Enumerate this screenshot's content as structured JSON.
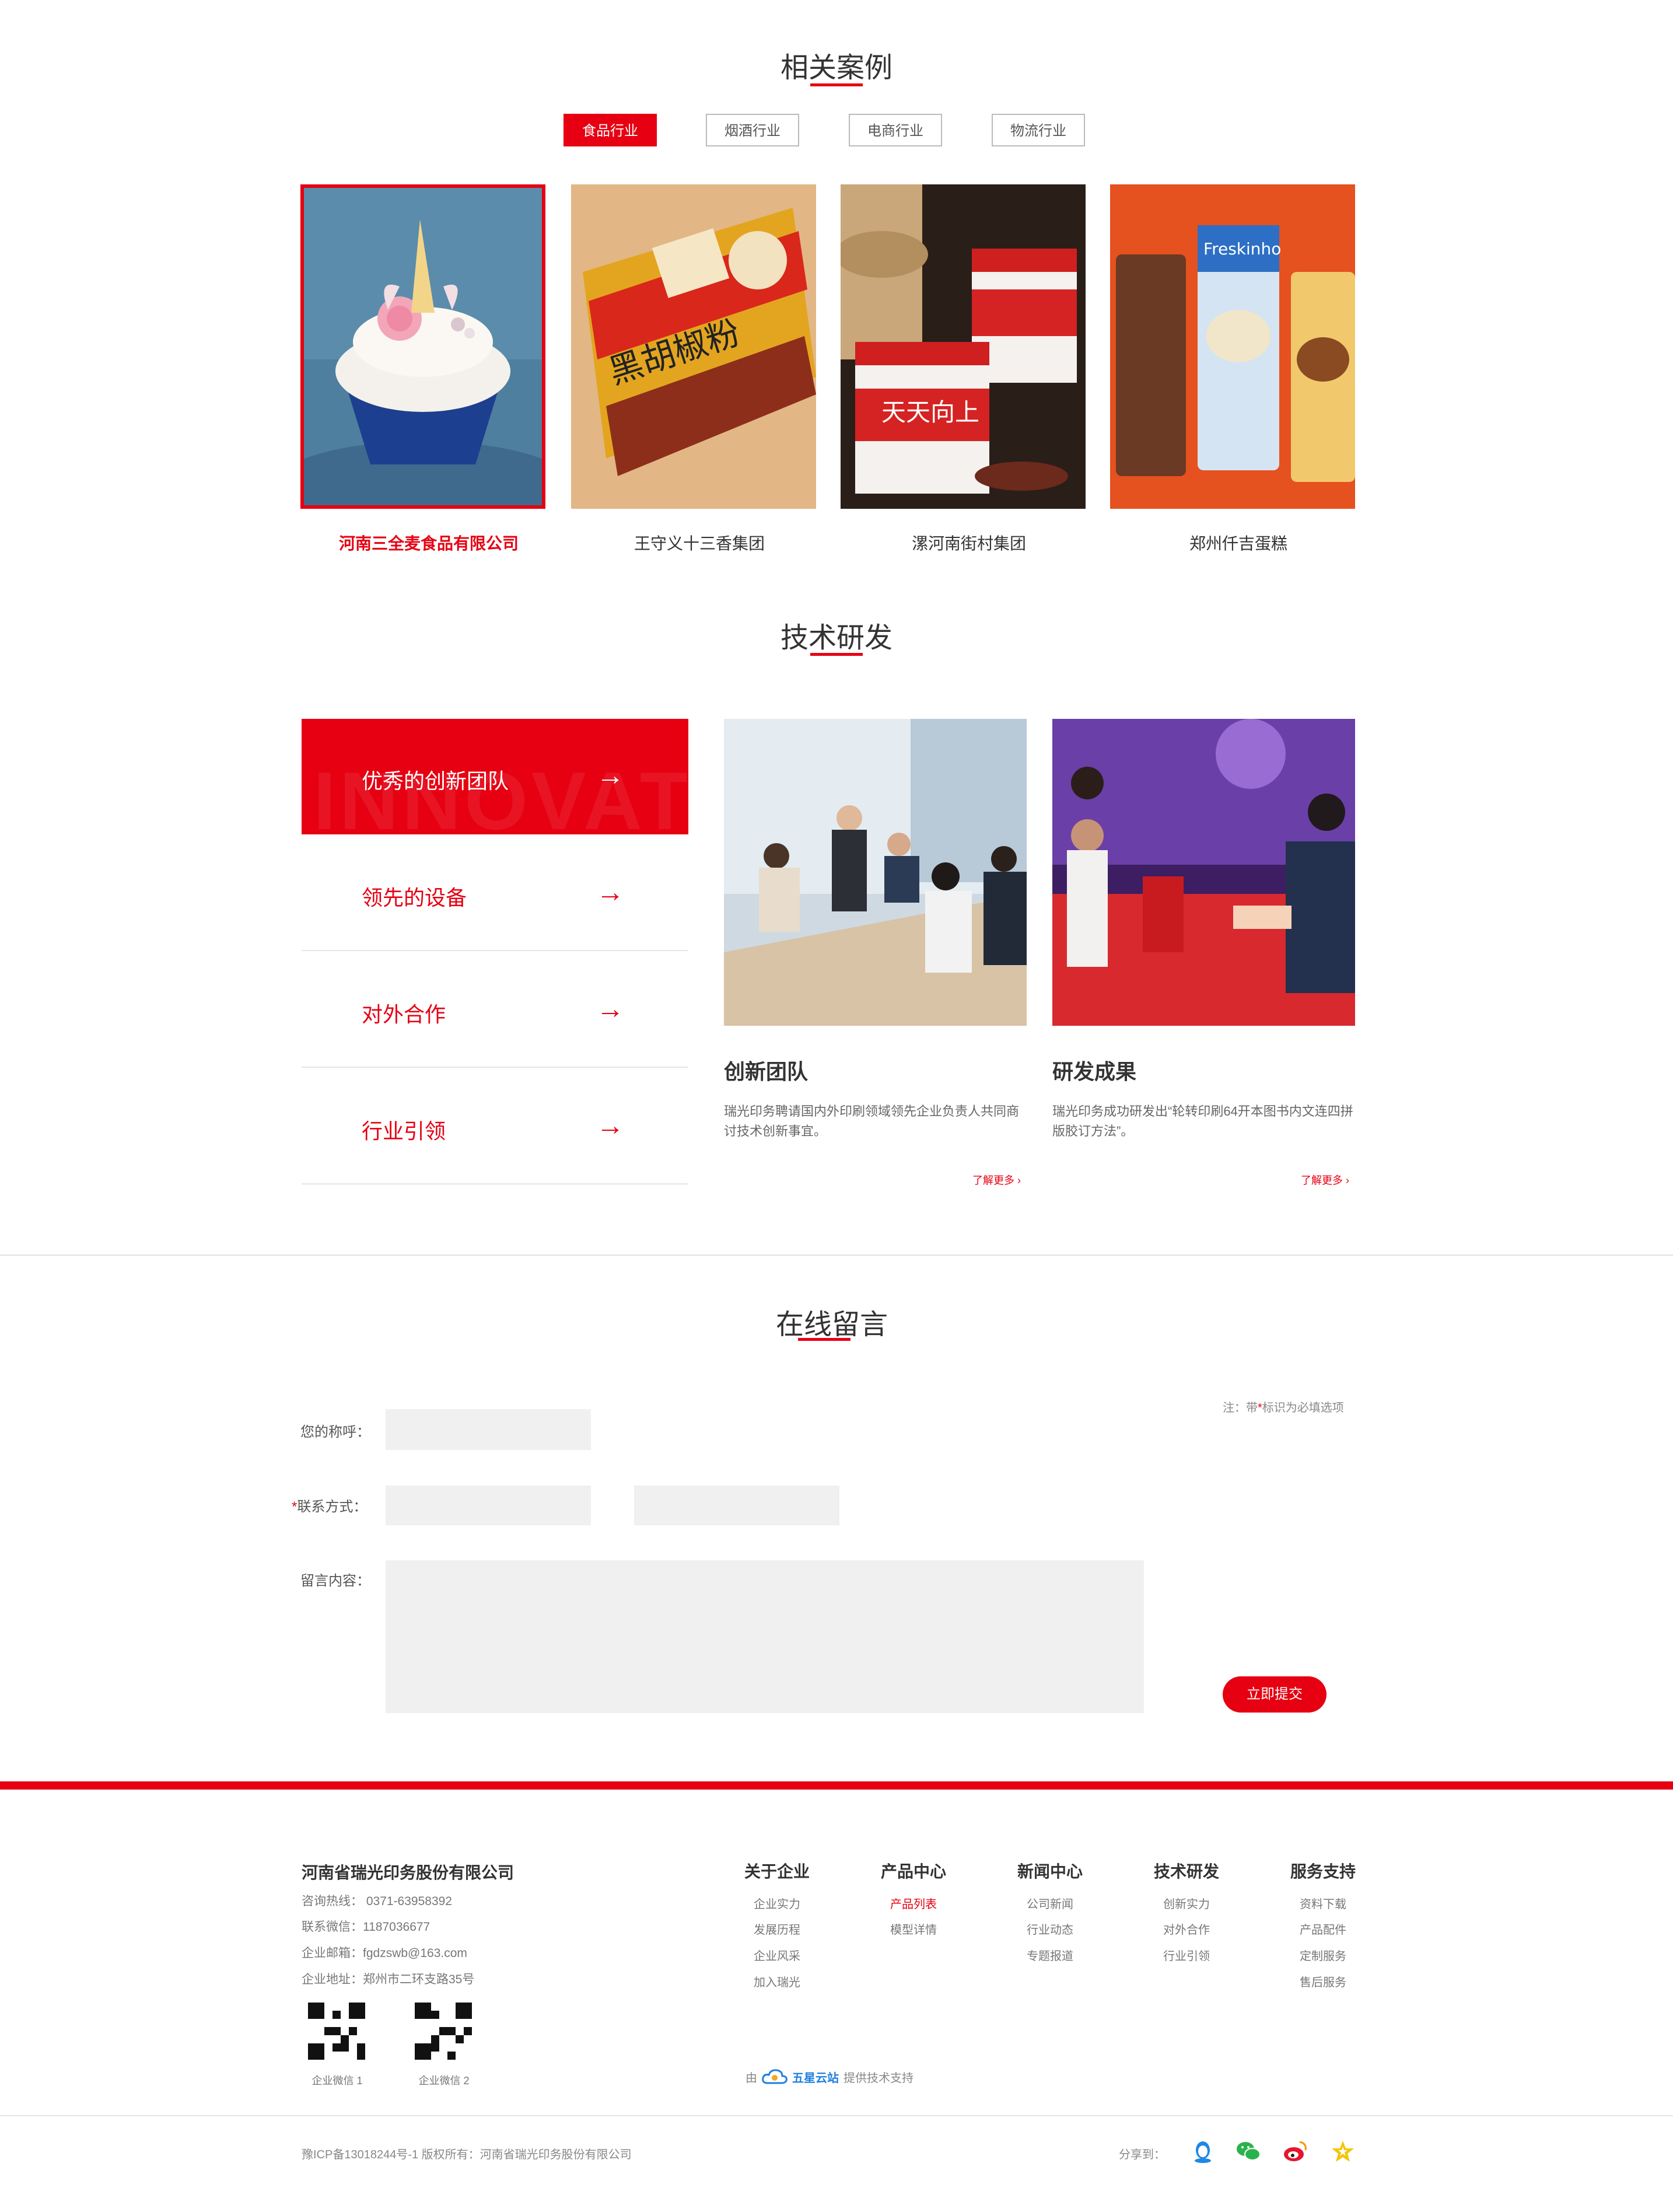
{
  "cases": {
    "title": "相关案例",
    "tabs": [
      "食品行业",
      "烟酒行业",
      "电商行业",
      "物流行业"
    ],
    "items": [
      "河南三全麦食品有限公司",
      "王守义十三香集团",
      "漯河南街村集团",
      "郑州仟吉蛋糕"
    ]
  },
  "tech": {
    "title": "技术研发",
    "list": [
      "优秀的创新团队",
      "领先的设备",
      "对外合作",
      "行业引领"
    ],
    "ghost_text": "INNOVAT",
    "cards": [
      {
        "title": "创新团队",
        "desc": "瑞光印务聘请国内外印刷领域领先企业负责人共同商讨技术创新事宜。",
        "more": "了解更多 ›"
      },
      {
        "title": "研发成果",
        "desc": "瑞光印务成功研发出“轮转印刷64开本图书内文连四拼版胶订方法”。",
        "more": "了解更多 ›"
      }
    ]
  },
  "form": {
    "title": "在线留言",
    "note": "注：带",
    "note_star": "*",
    "note_tail": "标识为必填选项",
    "name_label": "您的称呼：",
    "contact_label": "联系方式：",
    "required_mark": "*",
    "message_label": "留言内容：",
    "submit": "立即提交"
  },
  "footer": {
    "company": "河南省瑞光印务股份有限公司",
    "hotline": "咨询热线： 0371-63958392",
    "wechat": "联系微信：1187036677",
    "email": "企业邮箱：fgdzswb@163.com",
    "address": "企业地址：郑州市二环支路35号",
    "qr_labels": [
      "企业微信 1",
      "企业微信 2"
    ],
    "columns": [
      {
        "head": "关于企业",
        "items": [
          "企业实力",
          "发展历程",
          "企业风采",
          "加入瑞光"
        ]
      },
      {
        "head": "产品中心",
        "items": [
          "产品列表",
          "模型详情"
        ]
      },
      {
        "head": "新闻中心",
        "items": [
          "公司新闻",
          "行业动态",
          "专题报道"
        ]
      },
      {
        "head": "技术研发",
        "items": [
          "创新实力",
          "对外合作",
          "行业引领"
        ]
      },
      {
        "head": "服务支持",
        "items": [
          "资料下载",
          "产品配件",
          "定制服务",
          "售后服务"
        ]
      }
    ],
    "support_prefix": "由",
    "support_brand": "五星云站",
    "support_suffix": "提供技术支持",
    "copyright": "豫ICP备13018244号-1  版权所有：河南省瑞光印务股份有限公司",
    "share_label": "分享到："
  },
  "colors": {
    "accent": "#e60012",
    "input_bg": "#f0f0f0"
  }
}
